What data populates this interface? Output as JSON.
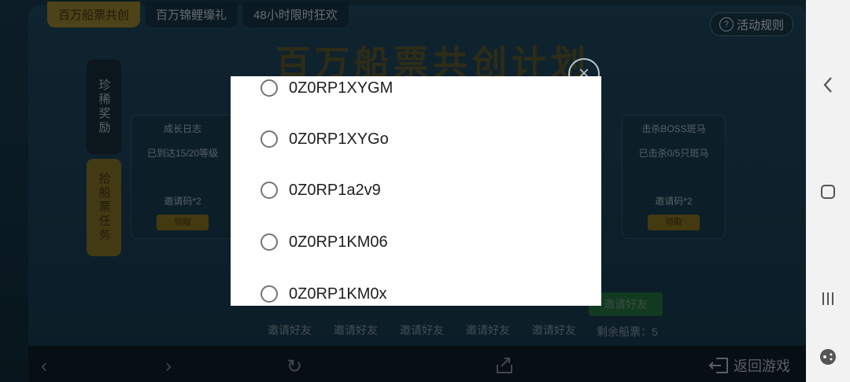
{
  "game": {
    "tabs": [
      {
        "label": "百万船票共创",
        "active": true
      },
      {
        "label": "百万锦鲤壕礼",
        "active": false
      },
      {
        "label": "48小时限时狂欢",
        "active": false
      }
    ],
    "rules_label": "活动规则",
    "big_title": "百万船票共创计划",
    "side_tabs": [
      "珍稀奖励",
      "拾船票任务"
    ],
    "cards": [
      {
        "title": "成长日志",
        "subtitle": "已到达15/20等级",
        "reward": "邀请码*2",
        "button": "领取"
      },
      {
        "title": "击杀BOSS斑马",
        "subtitle": "已击杀0/5只斑马",
        "reward": "邀请码*2",
        "button": "领取"
      }
    ],
    "invite_slots": [
      "邀请好友",
      "邀请好友",
      "邀请好友",
      "邀请好友",
      "邀请好友"
    ],
    "invite_button": "邀请好友",
    "remaining": "剩余船票：5",
    "return_label": "返回游戏"
  },
  "dialog": {
    "options": [
      {
        "label": "0Z0RP1XYGM",
        "selected": false
      },
      {
        "label": "0Z0RP1XYGo",
        "selected": false
      },
      {
        "label": "0Z0RP1a2v9",
        "selected": false
      },
      {
        "label": "0Z0RP1KM06",
        "selected": false
      },
      {
        "label": "0Z0RP1KM0x",
        "selected": false
      }
    ]
  },
  "icons": {
    "close": "close-icon",
    "back": "back-icon",
    "home": "home-icon",
    "recents": "recents-icon",
    "refresh": "refresh-icon",
    "share": "share-icon"
  },
  "colors": {
    "dialog_bg": "#ffffff",
    "radio_border": "#757575",
    "text": "#202020"
  }
}
